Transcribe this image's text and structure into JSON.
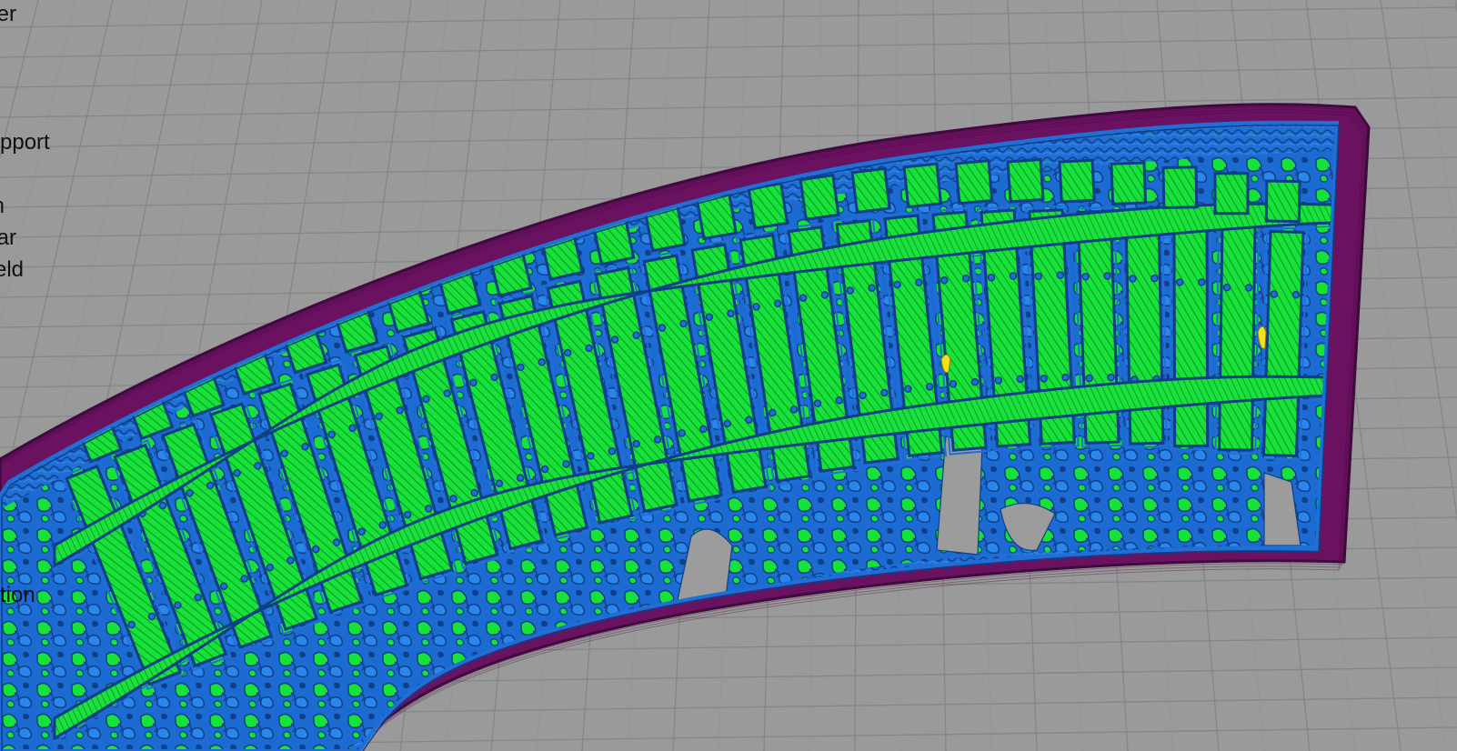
{
  "view": {
    "mode": "layer-preview",
    "background_color": "#9a9a9a",
    "grid_color": "#858585",
    "colors": {
      "skirt": "#6a1160",
      "skirt_dark": "#3f0a3d",
      "perimeter": "#1f6fd6",
      "perimeter_dark": "#0f3f86",
      "solid_infill": "#16e23a",
      "infill_hatch": "#0c7a1e",
      "support_highlight": "#f3e21a"
    }
  },
  "legend": {
    "items": [
      {
        "label": "er"
      },
      {
        "label": "pport"
      },
      {
        "label": "n"
      },
      {
        "label": "ar"
      },
      {
        "label": "eld"
      },
      {
        "label": "tion"
      }
    ]
  }
}
